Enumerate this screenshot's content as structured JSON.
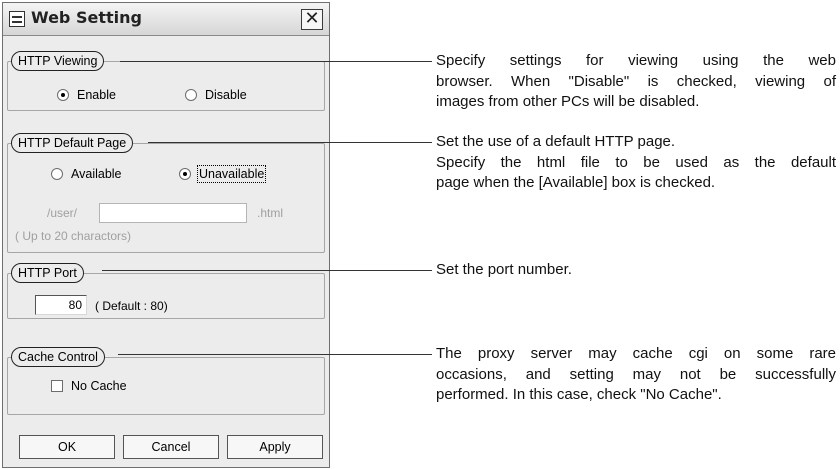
{
  "window": {
    "title": "Web Setting",
    "close_glyph": "✕"
  },
  "http_viewing": {
    "legend": "HTTP Viewing",
    "options": [
      {
        "label": "Enable",
        "checked": true
      },
      {
        "label": "Disable",
        "checked": false
      }
    ]
  },
  "http_default_page": {
    "legend": "HTTP Default Page",
    "options": [
      {
        "label": "Available",
        "checked": false
      },
      {
        "label": "Unavailable",
        "checked": true
      }
    ],
    "path_prefix": "/user/",
    "file_value": "",
    "path_suffix": ".html",
    "hint": "( Up to 20 charactors)"
  },
  "http_port": {
    "legend": "HTTP Port",
    "value": "80",
    "default_note": "( Default : 80)"
  },
  "cache_control": {
    "legend": "Cache Control",
    "checkbox_label": "No Cache",
    "checked": false
  },
  "buttons": {
    "ok": "OK",
    "cancel": "Cancel",
    "apply": "Apply"
  },
  "callouts": {
    "viewing": {
      "l1": "Specify settings for viewing using the web",
      "l2": "browser. When \"Disable\" is checked, viewing of",
      "l3": "images from other PCs will be disabled."
    },
    "default_page": {
      "l1": "Set the use of a default HTTP page.",
      "l2": "Specify the html file to be used as the default",
      "l3": "page when the [Available] box is checked."
    },
    "port": {
      "l1": "Set the port number."
    },
    "cache": {
      "l1": "The proxy server may cache cgi on some rare",
      "l2": "occasions, and setting may not be successfully",
      "l3": "performed. In this case, check \"No Cache\"."
    }
  }
}
